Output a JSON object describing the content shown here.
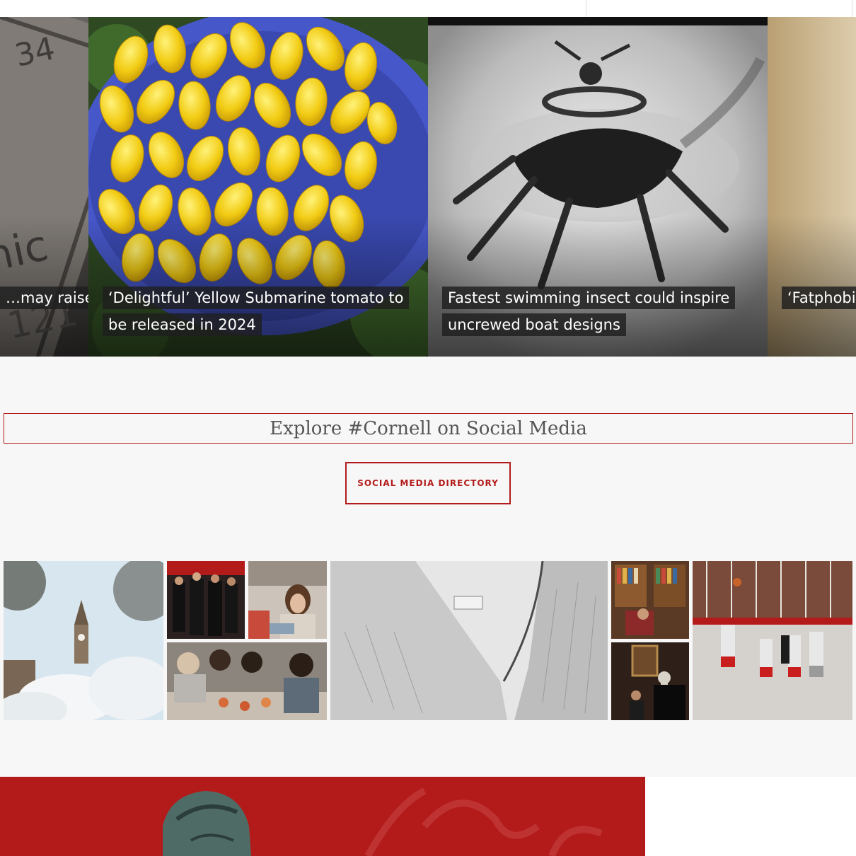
{
  "news_carousel": {
    "slides": [
      {
        "caption": "…may raise",
        "image": "periodic-table-element-photo"
      },
      {
        "caption": "‘Delightful’ Yellow Submarine tomato to be released in 2024",
        "image": "yellow-tomatoes-bowl-photo"
      },
      {
        "caption": "Fastest swimming insect could inspire uncrewed boat designs",
        "image": "swimming-insect-xray-photo"
      },
      {
        "caption": "‘Fatphobia… philosoph…",
        "image": "curtain-photo"
      }
    ]
  },
  "social": {
    "title": "Explore #Cornell on Social Media",
    "button_label": "SOCIAL MEDIA DIRECTORY",
    "tiles": [
      {
        "name": "clock-tower-snow-photo"
      },
      {
        "name": "graduation-ceremony-photo"
      },
      {
        "name": "student-studying-photo"
      },
      {
        "name": "students-workshop-photo"
      },
      {
        "name": "snowy-aerial-campus-photo"
      },
      {
        "name": "library-reading-room-photo"
      },
      {
        "name": "piano-room-photo"
      },
      {
        "name": "basketball-practice-photo"
      }
    ]
  },
  "colors": {
    "accent": "#b31b1b",
    "background": "#f7f7f7"
  }
}
